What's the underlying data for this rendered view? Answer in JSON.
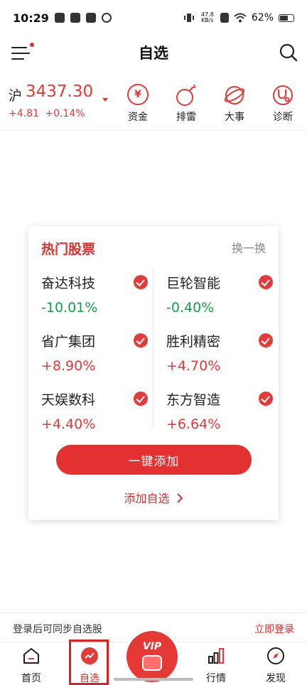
{
  "status_bar": {
    "time": "10:29",
    "net_speed_value": "47.8",
    "net_speed_unit": "KB/s",
    "battery": "62%",
    "battery_level": 0.62
  },
  "header": {
    "title": "自选"
  },
  "index": {
    "name": "沪",
    "value": "3437.30",
    "change": "+4.81",
    "change_pct": "+0.14%"
  },
  "tools": [
    {
      "label": "资金",
      "glyph": "¥"
    },
    {
      "label": "排雷",
      "glyph": ""
    },
    {
      "label": "大事",
      "glyph": ""
    },
    {
      "label": "诊断",
      "glyph": ""
    }
  ],
  "hot_stocks": {
    "title": "热门股票",
    "refresh_label": "换一换",
    "stocks": [
      {
        "name": "奋达科技",
        "change": "-10.01%",
        "trend": "down"
      },
      {
        "name": "巨轮智能",
        "change": "-0.40%",
        "trend": "down"
      },
      {
        "name": "省广集团",
        "change": "+8.90%",
        "trend": "up"
      },
      {
        "name": "胜利精密",
        "change": "+4.70%",
        "trend": "up"
      },
      {
        "name": "天娱数科",
        "change": "+4.40%",
        "trend": "up"
      },
      {
        "name": "东方智造",
        "change": "+6.64%",
        "trend": "up"
      }
    ],
    "add_all_label": "一键添加",
    "add_custom_label": "添加自选"
  },
  "login_bar": {
    "text": "登录后可同步自选股",
    "link": "立即登录"
  },
  "bottom_nav": {
    "home": "首页",
    "watchlist": "自选",
    "vip": "VIP",
    "market": "行情",
    "discover": "发现"
  },
  "colors": {
    "accent": "#e33a3a",
    "down": "#14a14a"
  }
}
